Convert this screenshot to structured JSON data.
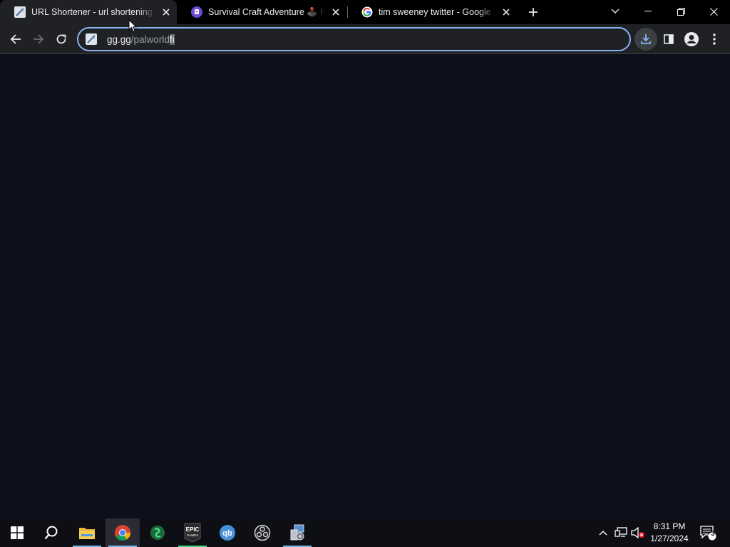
{
  "browser": {
    "tabs": [
      {
        "title": "URL Shortener - url shortening s",
        "icon": "gg-favicon-icon",
        "active": true
      },
      {
        "title": "Survival Craft Adventure 🕹️ Play",
        "icon": "twitch-favicon-icon",
        "active": false
      },
      {
        "title": "tim sweeney twitter - Google Se",
        "icon": "google-favicon-icon",
        "active": false
      }
    ],
    "omnibox": {
      "host": "gg.gg",
      "path": "/palworld",
      "selected": "fi"
    }
  },
  "taskbar": {
    "apps": [
      "windows-start-icon",
      "search-icon",
      "file-explorer-icon",
      "chrome-icon",
      "green-app-icon",
      "epic-games-icon",
      "qbittorrent-icon",
      "obs-icon",
      "system-tool-icon"
    ],
    "epic_label": "EPIC\nGAMES",
    "qb_label": "qb",
    "clock": {
      "time": "8:31 PM",
      "date": "1/27/2024"
    },
    "notification_count": "3"
  },
  "colors": {
    "accent": "#8ab4f8",
    "page_bg": "#0d0f1b",
    "chrome_dark": "#202124"
  }
}
